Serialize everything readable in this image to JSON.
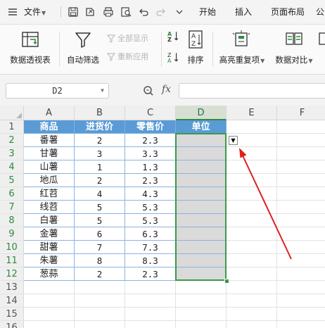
{
  "menubar": {
    "file_label": "文件",
    "tabs": [
      "开始",
      "插入",
      "页面布局",
      "公"
    ]
  },
  "ribbon": {
    "pivot_label": "数据透视表",
    "autofilter_label": "自动筛选",
    "show_all_label": "全部显示",
    "reapply_label": "重新应用",
    "sort_label": "排序",
    "highlight_dup_label": "高亮重复项",
    "compare_label": "数据对比"
  },
  "formula_bar": {
    "name_box": "D2",
    "fx_label": "fx",
    "formula_value": ""
  },
  "grid": {
    "columns": [
      "A",
      "B",
      "C",
      "D",
      "E",
      "F"
    ],
    "rows": [
      "1",
      "2",
      "3",
      "4",
      "5",
      "6",
      "7",
      "8",
      "9",
      "10",
      "11",
      "12",
      "13",
      "14",
      "15",
      "16"
    ],
    "selected_column": "D",
    "table": {
      "headers": [
        "商品",
        "进货价",
        "零售价",
        "单位"
      ],
      "rows": [
        [
          "番薯",
          "2",
          "2.3",
          ""
        ],
        [
          "甘薯",
          "3",
          "3.3",
          ""
        ],
        [
          "山薯",
          "1",
          "1.3",
          ""
        ],
        [
          "地瓜",
          "2",
          "2.3",
          ""
        ],
        [
          "红苕",
          "4",
          "4.3",
          ""
        ],
        [
          "线苕",
          "5",
          "5.3",
          ""
        ],
        [
          "白薯",
          "5",
          "5.3",
          ""
        ],
        [
          "金薯",
          "6",
          "6.3",
          ""
        ],
        [
          "甜薯",
          "7",
          "7.3",
          ""
        ],
        [
          "朱薯",
          "8",
          "8.3",
          ""
        ],
        [
          "葱蒜",
          "2",
          "2.3",
          ""
        ]
      ]
    }
  },
  "colors": {
    "header_fill": "#5b9bd5",
    "selection_border": "#3c9a4a",
    "arrow": "#e02020"
  }
}
